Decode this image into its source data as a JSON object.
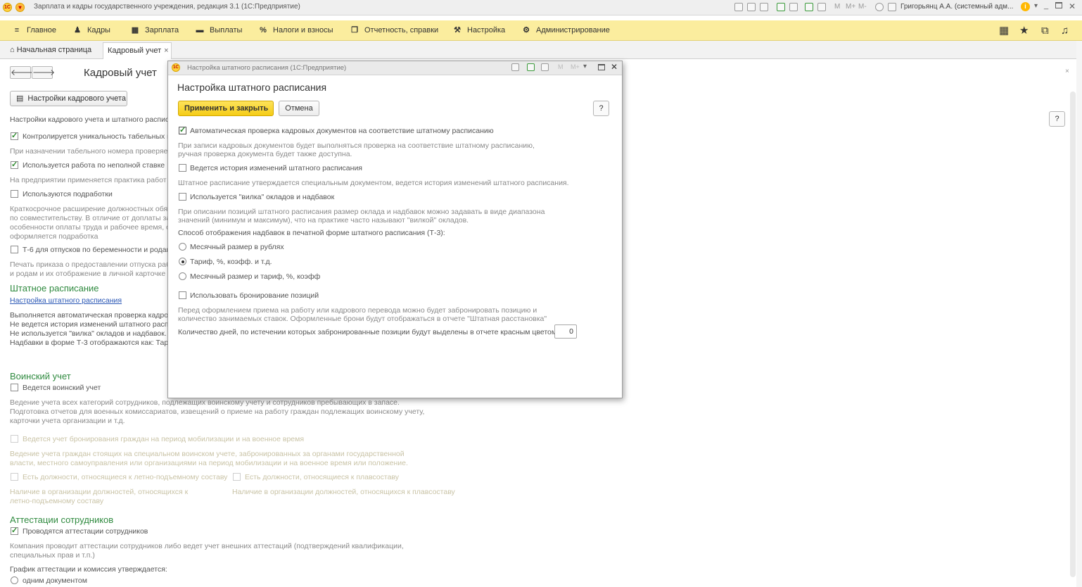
{
  "titlebar": {
    "title": "Зарплата и кадры государственного учреждения, редакция 3.1  (1С:Предприятие)",
    "user": "Григорьянц А.А. (системный адм...",
    "btn_m": "M",
    "btn_mplus": "M+",
    "btn_mminus": "M-"
  },
  "menubar": {
    "items": [
      {
        "label": "Главное"
      },
      {
        "label": "Кадры"
      },
      {
        "label": "Зарплата"
      },
      {
        "label": "Выплаты"
      },
      {
        "label": "Налоги и взносы"
      },
      {
        "label": "Отчетность, справки"
      },
      {
        "label": "Настройка"
      },
      {
        "label": "Администрирование"
      }
    ]
  },
  "tabs": {
    "home": "Начальная страница",
    "active": "Кадровый учет"
  },
  "page": {
    "title": "Кадровый учет",
    "settings_button": "Настройки кадрового учета",
    "intro": "Настройки кадрового учета и штатного распис",
    "opt_tabnum": "Контролируется уникальность табельных н",
    "opt_tabnum_desc": "При назначении табельного номера проверяе",
    "opt_parttime": "Используется работа по неполной ставке",
    "opt_parttime_desc": "На предприятии применяется практика работ",
    "opt_subwork": "Используются подработки",
    "opt_subwork_desc1": "Краткосрочное расширение должностных обяз",
    "opt_subwork_desc2": "по совместительству. В отличие от доплаты за",
    "opt_subwork_desc3": "особенности оплаты труда и рабочее время, о",
    "opt_subwork_desc4": "оформляется подработка",
    "opt_t6": "Т-6 для отпусков по беременности и родам",
    "opt_t6_desc1": "Печать приказа о предоставлении отпуска раб",
    "opt_t6_desc2": "и родам и их отображение в личной карточке (",
    "staff_section": "Штатное расписание",
    "staff_link": "Настройка штатного расписания",
    "staff_info1": "Выполняется автоматическая проверка кадров",
    "staff_info2": "Не ведется история изменений штатного распи",
    "staff_info3": "Не используется \"вилка\" окладов и надбавок.",
    "staff_info4": "Надбавки в форме Т-3 отображаются как: Тари",
    "military_section": "Воинский учет",
    "military_opt": "Ведется воинский учет",
    "military_desc1": "Ведение учета всех категорий сотрудников, подлежащих воинскому учету и сотрудников пребывающих в запасе.",
    "military_desc2": "Подготовка отчетов для военных комиссариатов, извещений о приеме на работу граждан подлежащих воинскому учету,",
    "military_desc3": "карточки учета организации и т.д.",
    "reserv_opt": "Ведется учет бронирования граждан на период мобилизации и на военное время",
    "reserv_desc1": "Ведение учета граждан стоящих на специальном воинском учете, забронированных за органами государственной",
    "reserv_desc2": "власти, местного самоуправления или организациями на период мобилизации и на военное время или положение.",
    "flight_opt": "Есть должности, относящиеся к летно-подъемному составу",
    "flight_desc1": "Наличие в организации должностей, относящихся к",
    "flight_desc2": "летно-подъемному составу",
    "sail_opt": "Есть должности, относящиеся к плавсоставу",
    "sail_desc": "Наличие в организации должностей, относящихся к плавсоставу",
    "attest_section": "Аттестации сотрудников",
    "attest_opt": "Проводятся аттестации сотрудников",
    "attest_desc1": "Компания проводит аттестации сотрудников либо ведет учет внешних аттестаций (подтверждений квалификации,",
    "attest_desc2": "специальных прав и т.п.)",
    "attest_sched": "График аттестации и комиссия утверждается:",
    "attest_radio1": "одним документом"
  },
  "dialog": {
    "window_title": "Настройка штатного расписания  (1С:Предприятие)",
    "form_title": "Настройка штатного расписания",
    "apply_button": "Применить и закрыть",
    "cancel_button": "Отмена",
    "help_button": "?",
    "auto_check": "Автоматическая проверка кадровых документов на соответствие штатному расписанию",
    "auto_check_desc1": "При записи кадровых документов будет выполняться проверка на соответствие штатному расписанию,",
    "auto_check_desc2": "ручная проверка документа будет также доступна.",
    "history": "Ведется история изменений штатного расписания",
    "history_desc": "Штатное расписание утверждается специальным документом, ведется история изменений штатного расписания.",
    "fork": "Используется \"вилка\" окладов и надбавок",
    "fork_desc1": "При описании позиций штатного расписания размер оклада и надбавок можно задавать в виде диапазона",
    "fork_desc2": "значений (минимум и максимум), что на практике часто называют \"вилкой\" окладов.",
    "display_label": "Способ отображения надбавок в печатной форме штатного расписания (Т-3):",
    "radio_monthly": "Месячный размер в рублях",
    "radio_tariff": "Тариф, %, коэфф. и т.д.",
    "radio_both": "Месячный размер и тариф, %, коэфф",
    "booking": "Использовать бронирование позиций",
    "booking_desc1": "Перед оформлением приема на работу или кадрового перевода можно будет забронировать позицию и",
    "booking_desc2": "количество занимаемых ставок. Оформленные брони будут отображаться в отчете \"Штатная расстановка\"",
    "days_label": "Количество дней, по истечении которых забронированные позиции будут выделены в отчете красным цветом:",
    "days_value": "0"
  },
  "colors": {
    "menubar": "#fbed9e",
    "section": "#2f8a3f",
    "link": "#2a57b5",
    "primary_button": "#f9d323"
  }
}
